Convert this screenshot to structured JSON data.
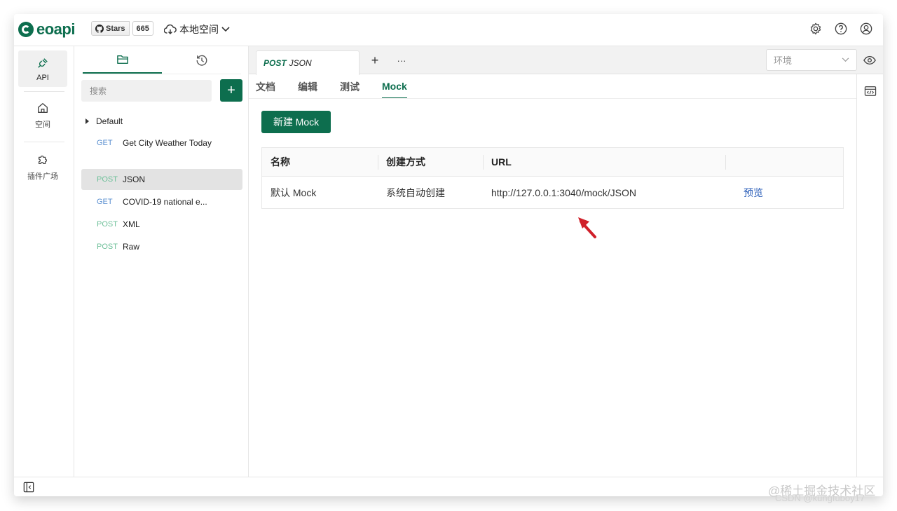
{
  "header": {
    "brand": "eoapi",
    "stars_label": "Stars",
    "stars_count": "665",
    "workspace": "本地空间"
  },
  "rail": {
    "items": [
      {
        "label": "API"
      },
      {
        "label": "空间"
      },
      {
        "label": "插件广场"
      }
    ]
  },
  "sidebar": {
    "search_placeholder": "搜索",
    "add_label": "+",
    "group": "Default",
    "apis": [
      {
        "method": "GET",
        "name": "Get City Weather Today"
      },
      {
        "method": "POST",
        "name": "JSON"
      },
      {
        "method": "GET",
        "name": "COVID-19 national e..."
      },
      {
        "method": "POST",
        "name": "XML"
      },
      {
        "method": "POST",
        "name": "Raw"
      }
    ]
  },
  "main": {
    "tab": {
      "method": "POST",
      "name": "JSON"
    },
    "tab_add": "+",
    "tab_more": "···",
    "env_placeholder": "环境",
    "subtabs": [
      "文档",
      "编辑",
      "测试",
      "Mock"
    ],
    "new_mock_label": "新建 Mock",
    "table": {
      "headers": [
        "名称",
        "创建方式",
        "URL",
        ""
      ],
      "rows": [
        {
          "name": "默认 Mock",
          "method": "系统自动创建",
          "url": "http://127.0.0.1:3040/mock/JSON",
          "action": "预览"
        }
      ]
    }
  },
  "watermark": {
    "line1": "@稀土掘金技术社区",
    "line2": "CSDN @kungfuboy17"
  },
  "colors": {
    "accent": "#0d6e4e",
    "get": "#5a8fd0",
    "post": "#6fc09a",
    "link": "#2a5db8",
    "arrow": "#d0202a"
  }
}
